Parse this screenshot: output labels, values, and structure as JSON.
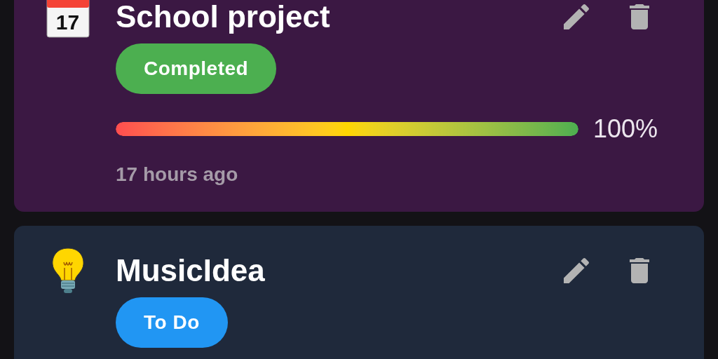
{
  "tasks": [
    {
      "kind": "calendar",
      "date": "17",
      "title": "School project",
      "color": "#3b1843",
      "status": {
        "label": "Completed",
        "color": "#4caf50"
      },
      "progress": {
        "level": 1,
        "reading": "100%"
      },
      "time": "17 hours ago"
    },
    {
      "kind": "bulb",
      "title": "MusicIdea",
      "color": "#1f293b",
      "status": {
        "label": "To Do",
        "color": "#2196f3"
      }
    }
  ]
}
